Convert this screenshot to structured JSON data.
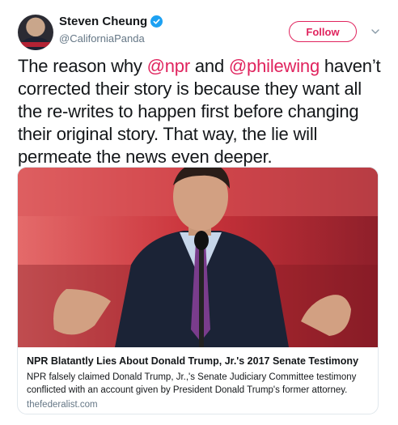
{
  "header": {
    "display_name": "Steven Cheung",
    "handle": "@CaliforniaPanda",
    "follow_label": "Follow",
    "verified_icon": "verified-badge-icon",
    "menu_icon": "chevron-down-icon"
  },
  "tweet": {
    "line1_pre": "The reason why ",
    "mention1": "@npr",
    "line1_mid": " and ",
    "mention2": "@philewing",
    "rest": " haven’t corrected their story is because they want all the re-writes to happen first before changing their original story. That way, the lie will permeate the news even deeper."
  },
  "card": {
    "title": "NPR Blatantly Lies About Donald Trump, Jr.'s 2017 Senate Testimony",
    "description": "NPR falsely claimed Donald Trump, Jr.,'s Senate Judiciary Committee testimony conflicted with an account given by President Donald Trump's former attorney.",
    "domain": "thefederalist.com"
  },
  "colors": {
    "accent": "#e0245e",
    "verified": "#1da1f2",
    "secondary_text": "#657786",
    "border": "#e1e8ed"
  }
}
